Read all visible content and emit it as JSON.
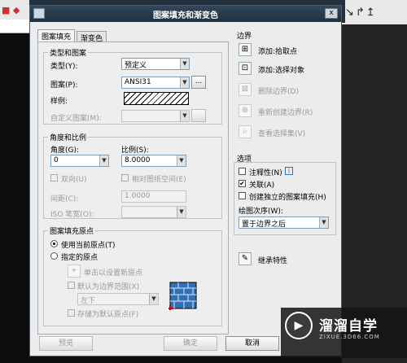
{
  "dialog": {
    "title": "图案填充和渐变色",
    "close_label": "x"
  },
  "tabs": [
    {
      "label": "图案填充"
    },
    {
      "label": "渐变色"
    }
  ],
  "type_pattern": {
    "group_title": "类型和图案",
    "type_label": "类型(Y):",
    "type_value": "预定义",
    "pattern_label": "图案(P):",
    "pattern_value": "ANSI31",
    "browse_label": "...",
    "sample_label": "样例:",
    "custom_label": "自定义图案(M):"
  },
  "angle_scale": {
    "group_title": "角度和比例",
    "angle_label": "角度(G):",
    "angle_value": "0",
    "scale_label": "比例(S):",
    "scale_value": "8.0000",
    "double_label": "双向(U)",
    "relative_label": "相对图纸空间(E)",
    "spacing_label": "间距(C):",
    "spacing_value": "1.0000",
    "iso_label": "ISO 笔宽(O):"
  },
  "origin": {
    "group_title": "图案填充原点",
    "use_current": "使用当前原点(T)",
    "specified": "指定的原点",
    "click_set": "单击以设置新原点",
    "default_extents": "默认为边界范围(X)",
    "extents_value": "左下",
    "store_default": "存储为默认原点(F)"
  },
  "boundary": {
    "group_title": "边界",
    "add_pick": "添加:拾取点",
    "add_select": "添加:选择对象",
    "remove": "删除边界(D)",
    "recreate": "重新创建边界(R)",
    "view_sel": "查看选择集(V)"
  },
  "options": {
    "group_title": "选项",
    "annotative": "注释性(N)",
    "info_icon_label": "i",
    "associative": "关联(A)",
    "separate": "创建独立的图案填充(H)",
    "draw_order_label": "绘图次序(W):",
    "draw_order_value": "置于边界之后"
  },
  "inherit": "继承特性",
  "footer": {
    "preview": "预览",
    "ok": "确定",
    "cancel": "取消"
  },
  "watermark": {
    "name": "溜溜自学",
    "url": "ZIXUE.3D66.COM"
  }
}
